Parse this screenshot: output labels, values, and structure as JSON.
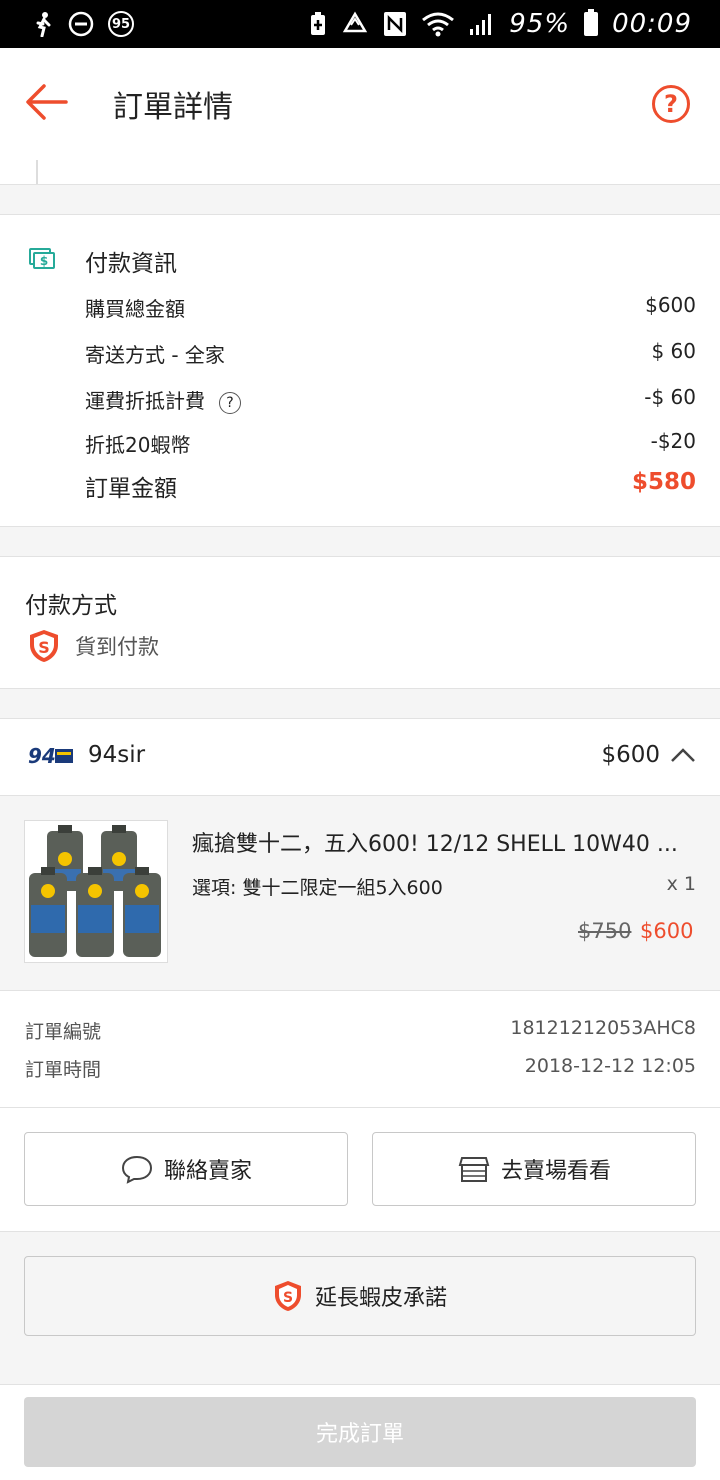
{
  "status_bar": {
    "left_icons": [
      "person-walking-icon",
      "minus-circle-icon",
      "badge-95-icon"
    ],
    "badge_text": "95",
    "right_icons": [
      "battery-saver-icon",
      "recycle-icon",
      "nfc-icon",
      "wifi-icon",
      "signal-icon"
    ],
    "battery_text": "95%",
    "time": "00:09"
  },
  "header": {
    "title": "訂單詳情",
    "help_label": "?"
  },
  "payment_info": {
    "title": "付款資訊",
    "rows": [
      {
        "label": "購買總金額",
        "value": "$600"
      },
      {
        "label": "寄送方式 - 全家",
        "value": "$ 60"
      },
      {
        "label": "運費折抵計費",
        "value": "-$ 60",
        "help": "?"
      },
      {
        "label": "折抵20蝦幣",
        "value": "-$20"
      }
    ],
    "total_label": "訂單金額",
    "total_value": "$580"
  },
  "payment_method": {
    "title": "付款方式",
    "method": "貨到付款"
  },
  "shop": {
    "name": "94sir",
    "price": "$600"
  },
  "product": {
    "name": "瘋搶雙十二，五入600! 12/12 SHELL 10W40 ...",
    "variant": "選項: 雙十二限定一組5入600",
    "quantity": "x 1",
    "original_price": "$750",
    "price": "$600"
  },
  "order": {
    "rows": [
      {
        "label": "訂單編號",
        "value": "18121212053AHC8"
      },
      {
        "label": "訂單時間",
        "value": "2018-12-12 12:05"
      }
    ]
  },
  "actions": {
    "contact_seller": "聯絡賣家",
    "visit_shop": "去賣場看看",
    "extend_guarantee": "延長蝦皮承諾",
    "complete_order": "完成訂單"
  },
  "colors": {
    "accent": "#ee4d2d",
    "teal": "#26aa99",
    "disabled": "#d5d5d5"
  }
}
